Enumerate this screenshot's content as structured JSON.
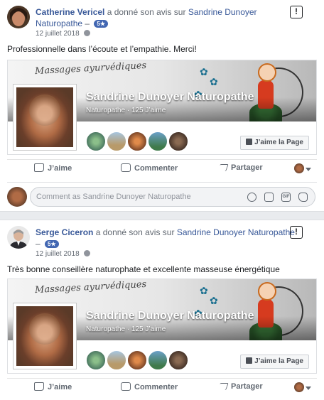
{
  "posts": [
    {
      "author": "Catherine Vericel",
      "verb": "a donné son avis sur",
      "page": "Sandrine Dunoyer Naturopathe",
      "dash": "–",
      "rating": "5★",
      "date": "12 juillet 2018",
      "text": "Professionnelle dans l’écoute et l’empathie. Merci!",
      "card": {
        "cover_line1": "Massages ayurvédiques",
        "title": "Sandrine Dunoyer Naturopathe",
        "subtitle": "Naturopathe · 125 J’aime",
        "like_page": "J’aime la Page"
      },
      "actions": {
        "like": "J’aime",
        "comment": "Commenter",
        "share": "Partager"
      },
      "comment_placeholder": "Comment as Sandrine Dunoyer Naturopathe"
    },
    {
      "author": "Serge Ciceron",
      "verb": "a donné son avis sur",
      "page": "Sandrine Dunoyer Naturopathe",
      "dash": "–",
      "rating": "5★",
      "date": "12 juillet 2018",
      "text": "Très bonne conseillère naturophate et excellente masseuse énergétique",
      "card": {
        "cover_line1": "Massages ayurvédiques",
        "title": "Sandrine Dunoyer Naturopathe",
        "subtitle": "Naturopathe · 125 J’aime",
        "like_page": "J’aime la Page"
      },
      "actions": {
        "like": "J’aime",
        "comment": "Commenter",
        "share": "Partager"
      }
    }
  ],
  "report_glyph": "!",
  "gif_glyph": "GIF",
  "colors": {
    "link": "#385898",
    "badge": "#4267b2",
    "separator": "#e9ebee"
  }
}
